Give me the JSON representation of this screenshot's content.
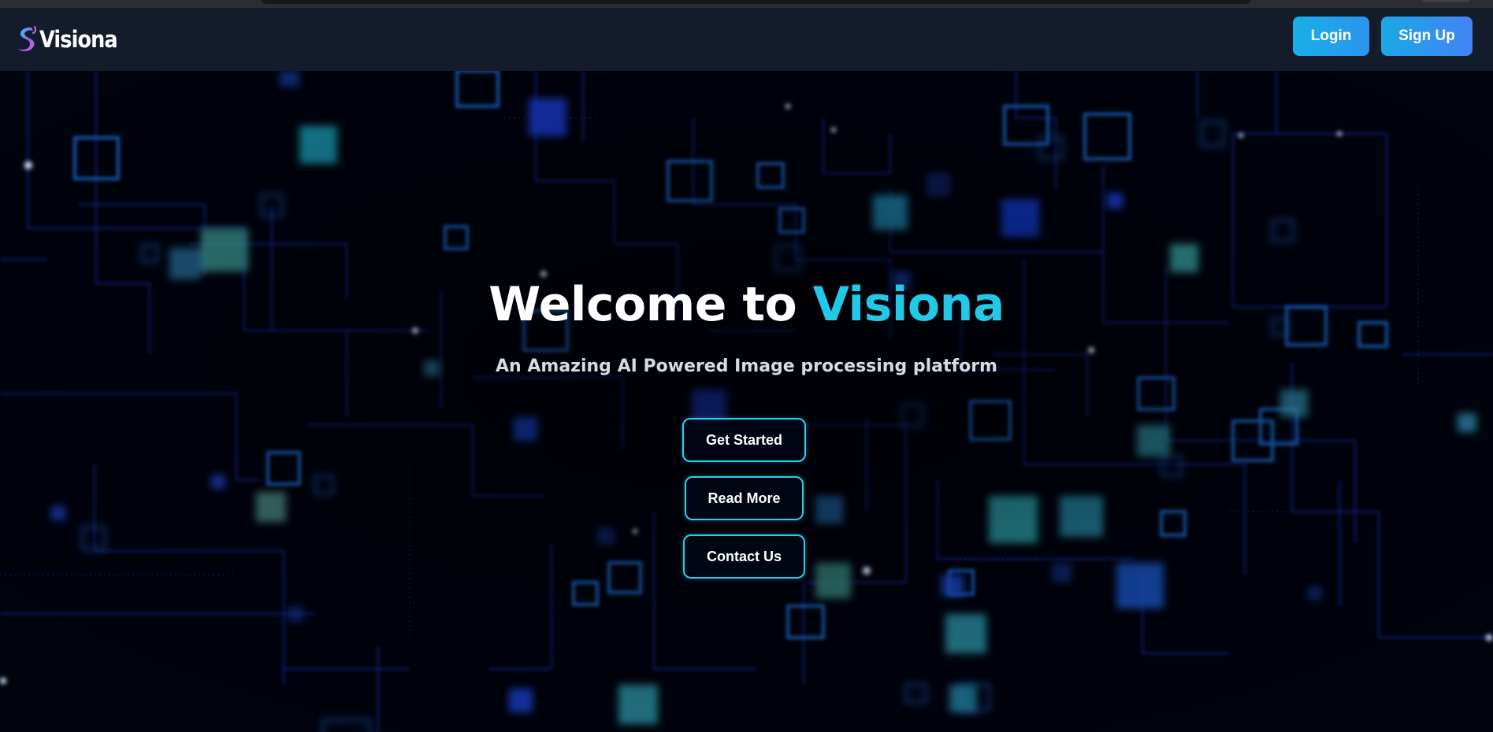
{
  "nav": {
    "brand_name": "Visiona",
    "login_label": "Login",
    "signup_label": "Sign Up"
  },
  "hero": {
    "title_prefix": "Welcome to ",
    "title_accent": "Visiona",
    "subtitle": "An Amazing AI Powered Image processing platform",
    "get_started_label": "Get Started",
    "read_more_label": "Read More",
    "contact_label": "Contact Us"
  },
  "colors": {
    "accent": "#22c9e6",
    "navbar": "#141c2c",
    "button_gradient_start": "#1aa9e2",
    "button_gradient_end": "#3a86f2",
    "background": "#01020a",
    "circuit_blue": "#1f3cff",
    "circuit_cyan": "#2fb3c9"
  },
  "icons": {
    "brand": "swirl-logo-icon",
    "background": "circuit-board-pattern"
  }
}
